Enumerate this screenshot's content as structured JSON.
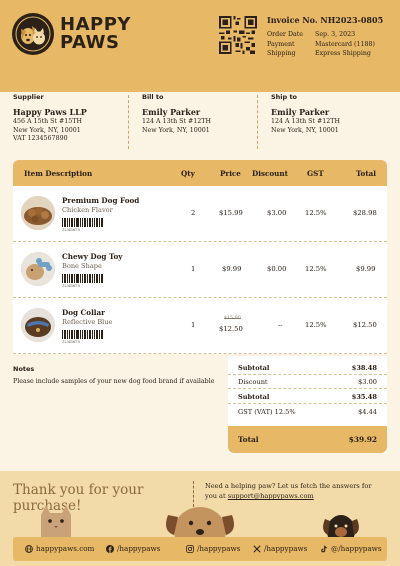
{
  "brand": {
    "name_line1": "HAPPY",
    "name_line2": "PAWS",
    "logo_icon": "dog-cat-logo-icon"
  },
  "invoice": {
    "number": "Invoice No. NH2023-0805",
    "meta": [
      {
        "label": "Order Date",
        "value": "Sep. 3, 2023"
      },
      {
        "label": "Payment",
        "value": "Mastercard (1188)"
      },
      {
        "label": "Shipping",
        "value": "Express Shipping"
      }
    ]
  },
  "parties": {
    "supplier": {
      "heading": "Supplier",
      "name": "Happy Paws LLP",
      "line1": "456 A 15th St #15TH",
      "line2": "New York, NY, 10001",
      "line3": "VAT 1234567890"
    },
    "bill_to": {
      "heading": "Bill to",
      "name": "Emily Parker",
      "line1": "124 A 13th St #12TH",
      "line2": "New York, NY, 10001"
    },
    "ship_to": {
      "heading": "Ship to",
      "name": "Emily Parker",
      "line1": "124 A 13th St #12TH",
      "line2": "New York, NY, 10001"
    }
  },
  "table": {
    "headers": {
      "item": "Item Description",
      "qty": "Qty",
      "price": "Price",
      "discount": "Discount",
      "gst": "GST",
      "total": "Total"
    },
    "rows": [
      {
        "name": "Premium Dog Food",
        "variant": "Chicken Flavor",
        "barcode": "12345678",
        "qty": "2",
        "price_old": "",
        "price": "$15.99",
        "discount": "$3.00",
        "gst": "12.5%",
        "total": "$28.98",
        "image_icon": "dog-food-product-image"
      },
      {
        "name": "Chewy Dog Toy",
        "variant": "Bone Shape",
        "barcode": "12345678",
        "qty": "1",
        "price_old": "",
        "price": "$9.99",
        "discount": "$0.00",
        "gst": "12.5%",
        "total": "$9.99",
        "image_icon": "dog-toy-product-image"
      },
      {
        "name": "Dog Collar",
        "variant": "Reflective Blue",
        "barcode": "12345678",
        "qty": "1",
        "price_old": "$15.00",
        "price": "$12.50",
        "discount": "--",
        "gst": "12.5%",
        "total": "$12.50",
        "image_icon": "dog-collar-product-image"
      }
    ]
  },
  "notes": {
    "heading": "Notes",
    "text": "Please include samples of your new dog food brand if available"
  },
  "totals": {
    "subtotal_label": "Subtotal",
    "subtotal": "$38.48",
    "discount_label": "Discount",
    "discount": "$3.00",
    "subtotal2_label": "Subtotal",
    "subtotal2": "$35.48",
    "gst_label": "GST (VAT) 12.5%",
    "gst": "$4.44",
    "total_label": "Total",
    "total": "$39.92"
  },
  "footer": {
    "thanks": "Thank you for your purchase!",
    "help_text": "Need a helping paw? Let us fetch the answers for you at ",
    "help_email": "support@happypaws.com",
    "socials": [
      {
        "icon": "globe-icon",
        "text": "happypaws.com"
      },
      {
        "icon": "facebook-icon",
        "text": "/happypaws"
      },
      {
        "icon": "instagram-icon",
        "text": "/happypaws"
      },
      {
        "icon": "x-twitter-icon",
        "text": "/happypaws"
      },
      {
        "icon": "tiktok-icon",
        "text": "@/happypaws"
      }
    ]
  },
  "colors": {
    "accent": "#e7b866",
    "background": "#fbf3e4",
    "footer": "#f3dba9",
    "text": "#2b2118"
  }
}
